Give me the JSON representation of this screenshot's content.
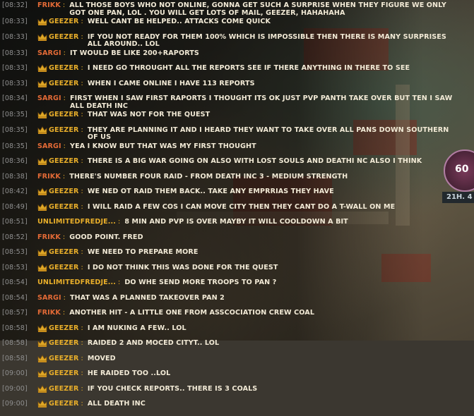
{
  "side_badge": "60",
  "side_timer": "21H. 4",
  "messages": [
    {
      "time": "[08:32]",
      "name": "FRIKK",
      "crown": false,
      "msg": "ALL THOSE BOYS WHO NOT ONLINE, GONNA GET SUCH A SURPRISE WHEN THEY FIGURE WE ONLY GOT ONE PAN, LOL . YOU WILL GET LOTS OF MAIL, GEEZER, HAHAHAHA"
    },
    {
      "time": "[08:33]",
      "name": "GEEZER",
      "crown": true,
      "msg": "WELL CANT BE HELPED.. ATTACKS COME QUICK"
    },
    {
      "time": "[08:33]",
      "name": "GEEZER",
      "crown": true,
      "msg": "IF YOU NOT READY FOR THEM 100% WHICH IS IMPOSSIBLE THEN THERE IS MANY SURPRISES ALL AROUND.. LOL"
    },
    {
      "time": "[08:33]",
      "name": "SARGI",
      "crown": false,
      "msg": "IT WOULD BE LIKE 200+RAPORTS"
    },
    {
      "time": "[08:33]",
      "name": "GEEZER",
      "crown": true,
      "msg": "I NEED GO THROUGHT ALL THE REPORTS SEE IF THERE ANYTHING IN THERE TO SEE"
    },
    {
      "time": "[08:33]",
      "name": "GEEZER",
      "crown": true,
      "msg": "WHEN I CAME ONLINE I HAVE 113 REPORTS"
    },
    {
      "time": "[08:34]",
      "name": "SARGI",
      "crown": false,
      "msg": "FIRST WHEN I SAW FIRST RAPORTS I THOUGHT ITS OK JUST PVP PANTH TAKE OVER BUT TEN I SAW ALL DEATH INC"
    },
    {
      "time": "[08:35]",
      "name": "GEEZER",
      "crown": true,
      "msg": "THAT WAS NOT FOR THE QUEST"
    },
    {
      "time": "[08:35]",
      "name": "GEEZER",
      "crown": true,
      "msg": "THEY ARE PLANNING IT AND I HEARD THEY WANT TO TAKE OVER ALL PANS DOWN SOUTHERN OF US"
    },
    {
      "time": "[08:35]",
      "name": "SARGI",
      "crown": false,
      "msg": "YEA I KNOW BUT THAT WAS MY FIRST THOUGHT"
    },
    {
      "time": "[08:36]",
      "name": "GEEZER",
      "crown": true,
      "msg": "THERE IS A BIG WAR GOING ON ALSO WITH LOST SOULS AND DEATHI NC ALSO I THINK"
    },
    {
      "time": "[08:38]",
      "name": "FRIKK",
      "crown": false,
      "msg": "THERE'S NUMBER FOUR RAID - FROM DEATH INC 3 - MEDIUM STRENGTH"
    },
    {
      "time": "[08:42]",
      "name": "GEEZER",
      "crown": true,
      "msg": "WE NED OT RAID THEM BACK.. TAKE ANY EMPRRIAS THEY HAVE"
    },
    {
      "time": "[08:49]",
      "name": "GEEZER",
      "crown": true,
      "msg": "I WILL RAID A FEW COS I CAN MOVE CITY THEN THEY CANT DO A T-WALL ON ME"
    },
    {
      "time": "[08:51]",
      "name": "UNLIMITEDFREDJE...",
      "crown": false,
      "msg": "8 MIN AND PVP IS OVER MAYBY IT WILL COOLDOWN A BIT"
    },
    {
      "time": "[08:52]",
      "name": "FRIKK",
      "crown": false,
      "msg": "GOOD POINT. FRED"
    },
    {
      "time": "[08:53]",
      "name": "GEEZER",
      "crown": true,
      "msg": "WE NEED TO PREPARE MORE"
    },
    {
      "time": "[08:53]",
      "name": "GEEZER",
      "crown": true,
      "msg": "I DO NOT THINK THIS WAS DONE FOR THE QUEST"
    },
    {
      "time": "[08:54]",
      "name": "UNLIMITEDFREDJE...",
      "crown": false,
      "msg": "DO WHE SEND MORE TROOPS TO PAN ?"
    },
    {
      "time": "[08:54]",
      "name": "SARGI",
      "crown": false,
      "msg": "THAT WAS A PLANNED TAKEOVER PAN 2"
    },
    {
      "time": "[08:57]",
      "name": "FRIKK",
      "crown": false,
      "msg": "ANOTHER HIT - A LITTLE ONE FROM ASSCOCIATION CREW COAL"
    },
    {
      "time": "[08:58]",
      "name": "GEEZER",
      "crown": true,
      "msg": "I AM NUKING A FEW.. LOL"
    },
    {
      "time": "[08:58]",
      "name": "GEEZER",
      "crown": true,
      "msg": "RAIDED 2 AND MOCED CITYT.. LOL"
    },
    {
      "time": "[08:58]",
      "name": "GEEZER",
      "crown": true,
      "msg": "MOVED"
    },
    {
      "time": "[09:00]",
      "name": "GEEZER",
      "crown": true,
      "msg": "HE RAIDED TOO ..LOL"
    },
    {
      "time": "[09:00]",
      "name": "GEEZER",
      "crown": true,
      "msg": "IF YOU CHECK REPORTS.. THERE IS 3 COALS"
    },
    {
      "time": "[09:00]",
      "name": "GEEZER",
      "crown": true,
      "msg": "ALL DEATH INC"
    }
  ]
}
